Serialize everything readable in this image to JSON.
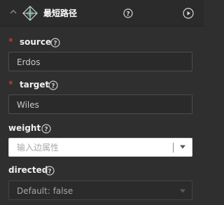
{
  "header": {
    "title": "最短路径",
    "collapse_icon": "chevron-up-icon",
    "node_icon": "path-diamond-icon",
    "help_icon": "help-circle-icon",
    "run_icon": "play-circle-icon"
  },
  "fields": {
    "source": {
      "label": "source",
      "required_mark": "*",
      "value": "Erdos"
    },
    "target": {
      "label": "target",
      "required_mark": "*",
      "value": "Wiles"
    },
    "weight": {
      "label": "weight",
      "placeholder": "输入边属性"
    },
    "directed": {
      "label": "directed",
      "selected": "Default: false"
    }
  },
  "colors": {
    "background": "#2f2f2f",
    "header_background": "#2b2b2b",
    "required": "#e0473c",
    "text": "#f0f0f0",
    "field_border": "#4d4d4d"
  }
}
